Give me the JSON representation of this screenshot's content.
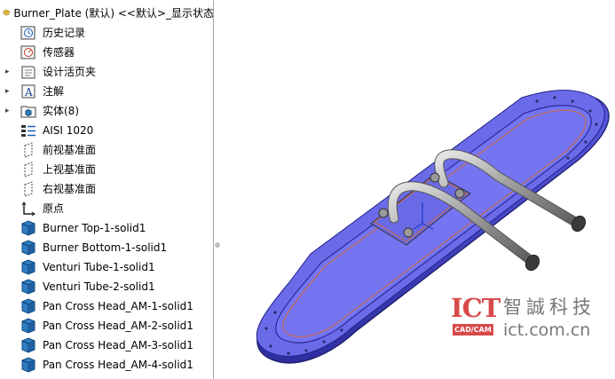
{
  "tree": {
    "root_label": "Burner_Plate (默认) <<默认>_显示状态",
    "items": [
      {
        "label": "历史记录",
        "icon": "history-icon",
        "expandable": false
      },
      {
        "label": "传感器",
        "icon": "sensor-icon",
        "expandable": false
      },
      {
        "label": "设计活页夹",
        "icon": "design-binder-icon",
        "expandable": true
      },
      {
        "label": "注解",
        "icon": "annotations-icon",
        "expandable": true
      },
      {
        "label": "实体(8)",
        "icon": "solid-bodies-icon",
        "expandable": true
      },
      {
        "label": "AISI 1020",
        "icon": "material-icon",
        "expandable": false
      },
      {
        "label": "前视基准面",
        "icon": "plane-icon",
        "expandable": false
      },
      {
        "label": "上视基准面",
        "icon": "plane-icon",
        "expandable": false
      },
      {
        "label": "右视基准面",
        "icon": "plane-icon",
        "expandable": false
      },
      {
        "label": "原点",
        "icon": "origin-icon",
        "expandable": false
      },
      {
        "label": "Burner Top-1-solid1",
        "icon": "part-body-icon",
        "expandable": false
      },
      {
        "label": "Burner Bottom-1-solid1",
        "icon": "part-body-icon",
        "expandable": false
      },
      {
        "label": "Venturi Tube-1-solid1",
        "icon": "part-body-icon",
        "expandable": false
      },
      {
        "label": "Venturi Tube-2-solid1",
        "icon": "part-body-icon",
        "expandable": false
      },
      {
        "label": "Pan Cross Head_AM-1-solid1",
        "icon": "part-body-icon",
        "expandable": false
      },
      {
        "label": "Pan Cross Head_AM-2-solid1",
        "icon": "part-body-icon",
        "expandable": false
      },
      {
        "label": "Pan Cross Head_AM-3-solid1",
        "icon": "part-body-icon",
        "expandable": false
      },
      {
        "label": "Pan Cross Head_AM-4-solid1",
        "icon": "part-body-icon",
        "expandable": false
      }
    ]
  },
  "watermark": {
    "logo_text": "ICT",
    "logo_sub": "CAD/CAM",
    "company_name": "智誠科技",
    "site": "ict.com.cn"
  },
  "colors": {
    "plate_top": "#6f6ff0",
    "plate_edge": "#3b3bb8",
    "accent_red": "#d84a4a",
    "tube": "#b9b9b9"
  }
}
